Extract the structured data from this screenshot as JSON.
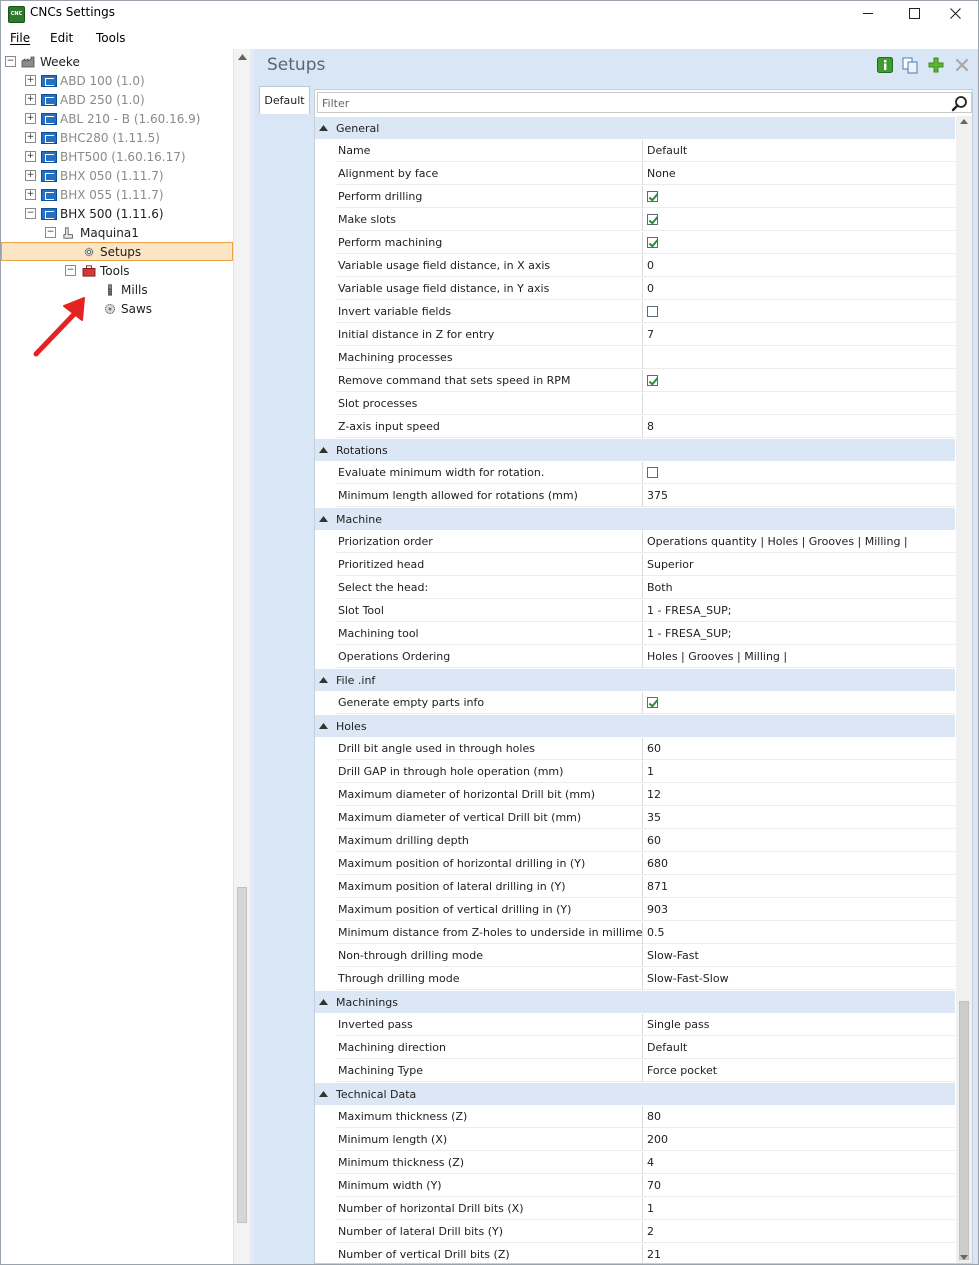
{
  "window": {
    "title": "CNCs Settings",
    "app_icon_text": "CNC"
  },
  "menu": [
    "File",
    "Edit",
    "Tools"
  ],
  "tree": {
    "root": "Weeke",
    "machines": [
      {
        "label": "ABD 100 (1.0)",
        "muted": true
      },
      {
        "label": "ABD 250 (1.0)",
        "muted": true
      },
      {
        "label": "ABL 210 - B (1.60.16.9)",
        "muted": true
      },
      {
        "label": "BHC280 (1.11.5)",
        "muted": true
      },
      {
        "label": "BHT500 (1.60.16.17)",
        "muted": true
      },
      {
        "label": "BHX 050 (1.11.7)",
        "muted": true
      },
      {
        "label": "BHX 055 (1.11.7)",
        "muted": true
      },
      {
        "label": "BHX 500 (1.11.6)",
        "muted": false
      }
    ],
    "machine_child": "Maquina1",
    "setups": "Setups",
    "tools": "Tools",
    "mills": "Mills",
    "saws": "Saws"
  },
  "right": {
    "title": "Setups",
    "tab": "Default",
    "filter_placeholder": "Filter"
  },
  "sections": [
    {
      "title": "General",
      "rows": [
        {
          "name": "Name",
          "value": "Default"
        },
        {
          "name": "Alignment by face",
          "value": "None"
        },
        {
          "name": "Perform drilling",
          "check": true
        },
        {
          "name": "Make slots",
          "check": true
        },
        {
          "name": "Perform machining",
          "check": true
        },
        {
          "name": "Variable usage field distance, in X axis",
          "value": "0"
        },
        {
          "name": "Variable usage field distance, in Y axis",
          "value": "0"
        },
        {
          "name": "Invert variable fields",
          "check": false
        },
        {
          "name": "Initial distance in Z for entry",
          "value": "7"
        },
        {
          "name": "Machining processes",
          "value": ""
        },
        {
          "name": "Remove command that sets speed in RPM",
          "check": true
        },
        {
          "name": "Slot processes",
          "value": ""
        },
        {
          "name": "Z-axis input speed",
          "value": "8"
        }
      ]
    },
    {
      "title": "Rotations",
      "rows": [
        {
          "name": "Evaluate minimum width for rotation.",
          "check": false
        },
        {
          "name": "Minimum length allowed for rotations (mm)",
          "value": "375"
        }
      ]
    },
    {
      "title": "Machine",
      "rows": [
        {
          "name": "Priorization order",
          "value": "Operations quantity | Holes | Grooves | Milling |"
        },
        {
          "name": "Prioritized head",
          "value": "Superior"
        },
        {
          "name": "Select the head:",
          "value": "Both"
        },
        {
          "name": "Slot Tool",
          "value": "1 - FRESA_SUP;"
        },
        {
          "name": "Machining tool",
          "value": "1 - FRESA_SUP;"
        },
        {
          "name": "Operations Ordering",
          "value": "Holes | Grooves | Milling |"
        }
      ]
    },
    {
      "title": "File .inf",
      "rows": [
        {
          "name": "Generate empty parts info",
          "check": true
        }
      ]
    },
    {
      "title": "Holes",
      "rows": [
        {
          "name": "Drill bit angle used in through holes",
          "value": "60"
        },
        {
          "name": "Drill GAP in through hole operation (mm)",
          "value": "1"
        },
        {
          "name": "Maximum diameter of horizontal Drill bit (mm)",
          "value": "12"
        },
        {
          "name": "Maximum diameter of vertical Drill bit (mm)",
          "value": "35"
        },
        {
          "name": "Maximum drilling depth",
          "value": "60"
        },
        {
          "name": "Maximum position of horizontal drilling in (Y)",
          "value": "680"
        },
        {
          "name": "Maximum position of lateral drilling in (Y)",
          "value": "871"
        },
        {
          "name": "Maximum position of vertical drilling in (Y)",
          "value": "903"
        },
        {
          "name": "Minimum distance from Z-holes to underside in millimeters.",
          "value": "0.5"
        },
        {
          "name": "Non-through drilling mode",
          "value": "Slow-Fast"
        },
        {
          "name": "Through drilling mode",
          "value": "Slow-Fast-Slow"
        }
      ]
    },
    {
      "title": "Machinings",
      "rows": [
        {
          "name": "Inverted pass",
          "value": "Single pass"
        },
        {
          "name": "Machining direction",
          "value": "Default"
        },
        {
          "name": "Machining Type",
          "value": "Force pocket"
        }
      ]
    },
    {
      "title": "Technical Data",
      "rows": [
        {
          "name": "Maximum thickness (Z)",
          "value": "80"
        },
        {
          "name": "Minimum length (X)",
          "value": "200"
        },
        {
          "name": "Minimum thickness (Z)",
          "value": "4"
        },
        {
          "name": "Minimum width (Y)",
          "value": "70"
        },
        {
          "name": "Number of horizontal Drill bits (X)",
          "value": "1"
        },
        {
          "name": "Number of lateral Drill bits (Y)",
          "value": "2"
        },
        {
          "name": "Number of vertical Drill bits (Z)",
          "value": "21"
        }
      ]
    }
  ],
  "colors": {
    "category_bg": "#dce7f5",
    "pane_bg": "#d9e6f5",
    "selected_bg": "#fce5c4",
    "check_green": "#2e8a3a",
    "annotation_red": "#e52222"
  },
  "icons": [
    "minimize-icon",
    "maximize-icon",
    "close-icon",
    "info-icon",
    "copy-icon",
    "add-icon",
    "delete-icon",
    "search-icon",
    "gear-icon",
    "toolbox-icon",
    "mill-icon",
    "saw-icon",
    "machine-icon"
  ]
}
